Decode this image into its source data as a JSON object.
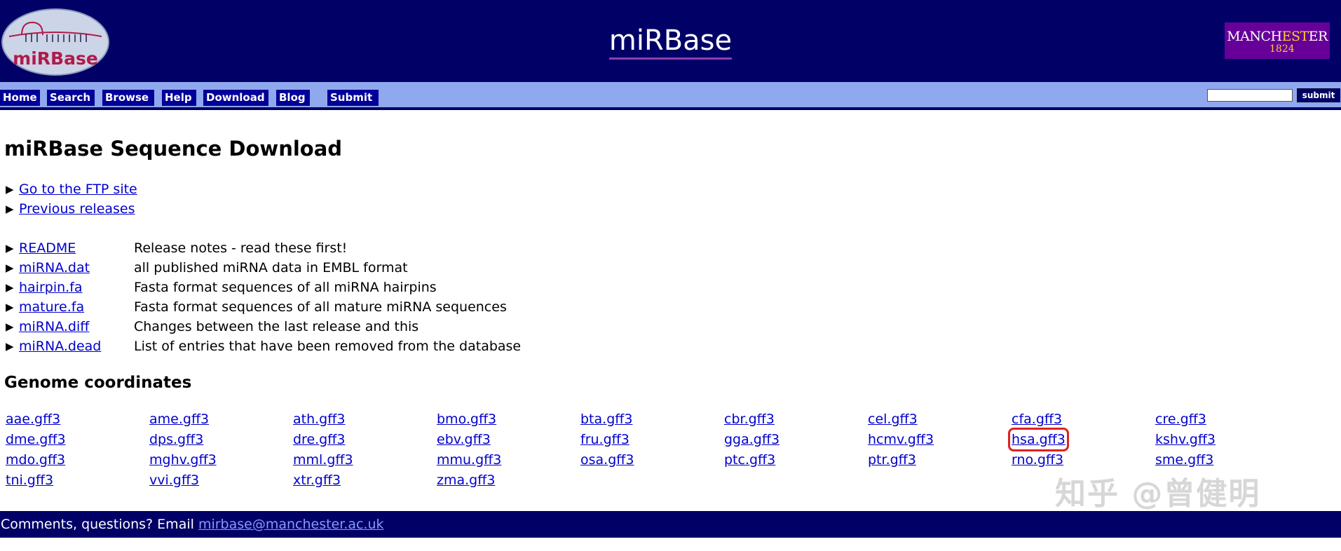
{
  "header": {
    "logo_text": "miRBase",
    "site_title": "miRBase",
    "university_logo": {
      "name_left": "MANCH",
      "name_highlight": "EST",
      "name_right": "ER",
      "year": "1824",
      "color": "#660099"
    }
  },
  "navbar": {
    "items": [
      {
        "label": "Home"
      },
      {
        "label": "Search"
      },
      {
        "label": "Browse"
      },
      {
        "label": "Help"
      },
      {
        "label": "Download"
      },
      {
        "label": "Blog"
      },
      {
        "label": "Submit"
      }
    ],
    "search_value": "",
    "search_submit": "submit"
  },
  "main": {
    "title": "miRBase Sequence Download",
    "links": [
      {
        "label": "Go to the FTP site"
      },
      {
        "label": "Previous releases"
      }
    ],
    "files": [
      {
        "name": "README",
        "desc": "Release notes - read these first!"
      },
      {
        "name": "miRNA.dat",
        "desc": "all published miRNA data in EMBL format"
      },
      {
        "name": "hairpin.fa",
        "desc": "Fasta format sequences of all miRNA hairpins"
      },
      {
        "name": "mature.fa",
        "desc": "Fasta format sequences of all mature miRNA sequences"
      },
      {
        "name": "miRNA.diff",
        "desc": "Changes between the last release and this"
      },
      {
        "name": "miRNA.dead",
        "desc": "List of entries that have been removed from the database"
      }
    ],
    "genome_heading": "Genome coordinates",
    "gff_files": [
      [
        "aae.gff3",
        "ame.gff3",
        "ath.gff3",
        "bmo.gff3",
        "bta.gff3",
        "cbr.gff3",
        "cel.gff3",
        "cfa.gff3",
        "cre.gff3"
      ],
      [
        "dme.gff3",
        "dps.gff3",
        "dre.gff3",
        "ebv.gff3",
        "fru.gff3",
        "gga.gff3",
        "hcmv.gff3",
        "hsa.gff3",
        "kshv.gff3"
      ],
      [
        "mdo.gff3",
        "mghv.gff3",
        "mml.gff3",
        "mmu.gff3",
        "osa.gff3",
        "ptc.gff3",
        "ptr.gff3",
        "rno.gff3",
        "sme.gff3"
      ],
      [
        "tni.gff3",
        "vvi.gff3",
        "xtr.gff3",
        "zma.gff3"
      ]
    ],
    "highlighted_file": "hsa.gff3",
    "highlight_color": "#e02020"
  },
  "watermark": "知乎 @曾健明",
  "footer": {
    "text": "Comments, questions? Email",
    "email": "mirbase@manchester.ac.uk"
  },
  "colors": {
    "header_bg": "#000066",
    "navbar_bg": "#8fa8ee",
    "nav_button_bg": "#000099",
    "link": "#0000cc"
  }
}
